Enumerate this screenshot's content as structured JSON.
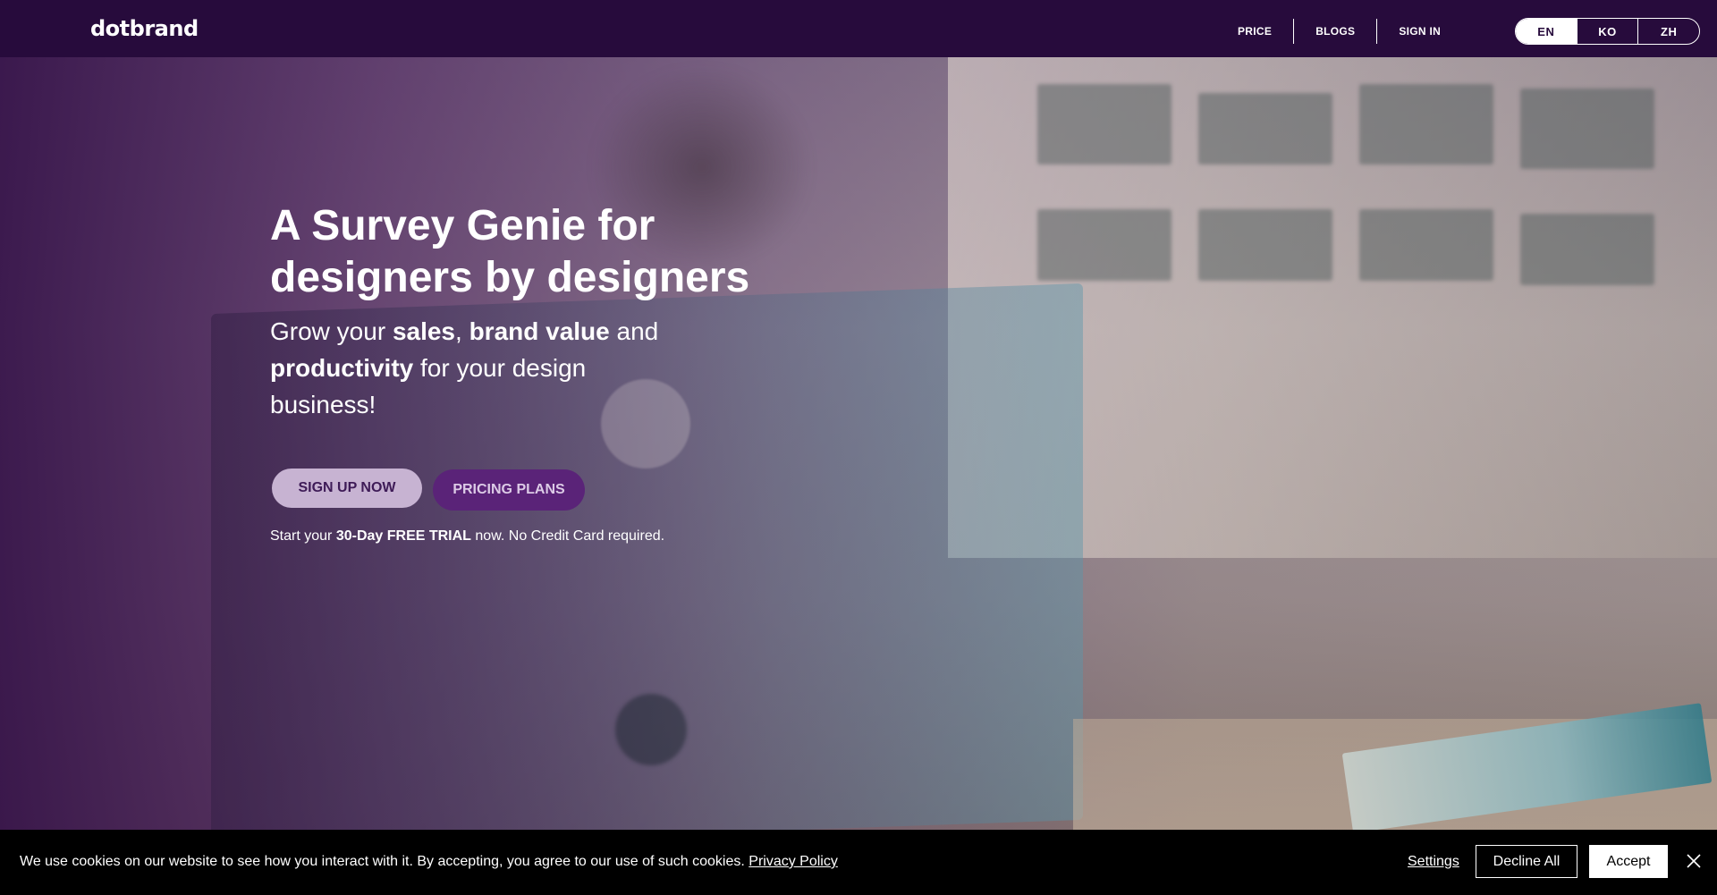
{
  "nav": {
    "logo": "dotbrand",
    "links": [
      "PRICE",
      "BLOGS",
      "SIGN IN"
    ],
    "languages": [
      "EN",
      "KO",
      "ZH"
    ],
    "active_language": "EN"
  },
  "hero": {
    "title": "A Survey Genie for designers by designers",
    "subtitle_parts": {
      "p1": "Grow your ",
      "b1": "sales",
      "p2": ", ",
      "b2": "brand value",
      "p3": " and ",
      "b3": "productivity",
      "p4": " for your design business!"
    },
    "signup_label": "SIGN UP NOW",
    "pricing_label": "PRICING PLANS",
    "trial": {
      "p1": "Start your ",
      "b1": "30-Day FREE TRIAL",
      "p2": " now. No Credit Card required."
    }
  },
  "cookie": {
    "text": "We use cookies on our website to see how you interact with it. By accepting, you agree to our use of such cookies. ",
    "policy_link": "Privacy Policy",
    "settings_label": "Settings",
    "decline_label": "Decline All",
    "accept_label": "Accept",
    "close_icon": "close-icon"
  },
  "colors": {
    "nav_bg": "#270b3c",
    "signup_bg": "#c7b3d2",
    "pricing_bg": "#5a2378",
    "cookie_bg": "#000000"
  }
}
